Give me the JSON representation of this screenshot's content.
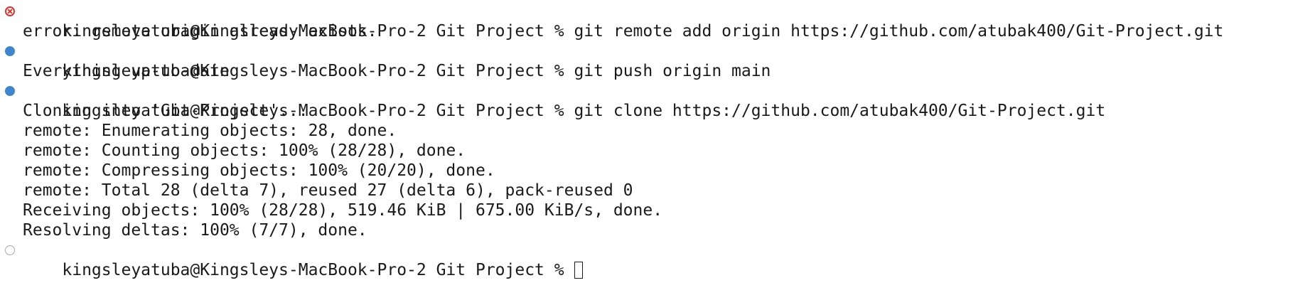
{
  "terminal": {
    "prompt": "kingsleyatuba@Kingsleys-MacBook-Pro-2 Git Project % ",
    "blocks": [
      {
        "status": "error",
        "command": "git remote add origin https://github.com/atubak400/Git-Project.git",
        "output": [
          "error: remote origin already exists."
        ]
      },
      {
        "status": "success",
        "command": "git push origin main",
        "output": [
          "Everything up-to-date"
        ]
      },
      {
        "status": "success",
        "command": "git clone https://github.com/atubak400/Git-Project.git",
        "output": [
          "Cloning into 'Git-Project'...",
          "remote: Enumerating objects: 28, done.",
          "remote: Counting objects: 100% (28/28), done.",
          "remote: Compressing objects: 100% (20/20), done.",
          "remote: Total 28 (delta 7), reused 27 (delta 6), pack-reused 0",
          "Receiving objects: 100% (28/28), 519.46 KiB | 675.00 KiB/s, done.",
          "Resolving deltas: 100% (7/7), done."
        ]
      },
      {
        "status": "pending",
        "command": "",
        "output": []
      }
    ],
    "colors": {
      "error_marker": "#d9322b",
      "success_marker": "#3f86d1",
      "pending_marker": "#a8a8a8",
      "text": "#1a1a1a",
      "background": "#ffffff"
    },
    "marker_icons": {
      "error": "error-x-circle-icon",
      "success": "filled-circle-icon",
      "pending": "hollow-circle-icon"
    }
  }
}
